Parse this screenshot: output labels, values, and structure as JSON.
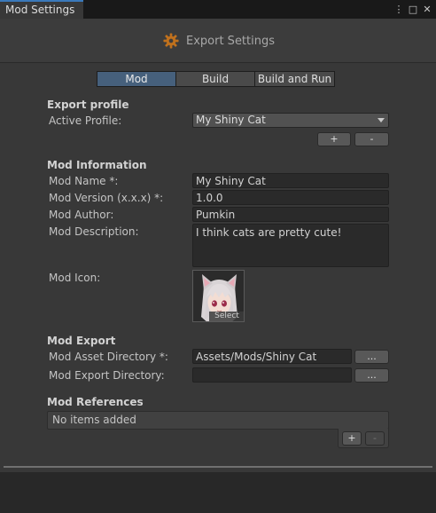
{
  "window": {
    "tab_title": "Mod Settings",
    "menu_icon": "⋮",
    "maximize_icon": "□",
    "close_icon": "✕"
  },
  "header": {
    "title": "Export Settings",
    "icon": "gear-icon",
    "accent_color": "#c0711d"
  },
  "tabs": [
    {
      "label": "Mod",
      "active": true
    },
    {
      "label": "Build",
      "active": false
    },
    {
      "label": "Build and Run",
      "active": false
    }
  ],
  "export_profile": {
    "section_title": "Export profile",
    "active_profile_label": "Active Profile:",
    "active_profile_value": "My Shiny Cat",
    "add_label": "+",
    "remove_label": "-"
  },
  "mod_information": {
    "section_title": "Mod Information",
    "name_label": "Mod Name *:",
    "name_value": "My Shiny Cat",
    "version_label": "Mod Version (x.x.x) *:",
    "version_value": "1.0.0",
    "author_label": "Mod Author:",
    "author_value": "Pumkin",
    "description_label": "Mod Description:",
    "description_value": "I think cats are pretty cute!",
    "icon_label": "Mod Icon:",
    "icon_select_label": "Select"
  },
  "mod_export": {
    "section_title": "Mod Export",
    "asset_dir_label": "Mod Asset Directory *:",
    "asset_dir_value": "Assets/Mods/Shiny Cat",
    "export_dir_label": "Mod Export Directory:",
    "export_dir_value": "",
    "browse_label": "..."
  },
  "mod_references": {
    "section_title": "Mod References",
    "empty_text": "No items added",
    "add_label": "+",
    "remove_label": "-"
  }
}
